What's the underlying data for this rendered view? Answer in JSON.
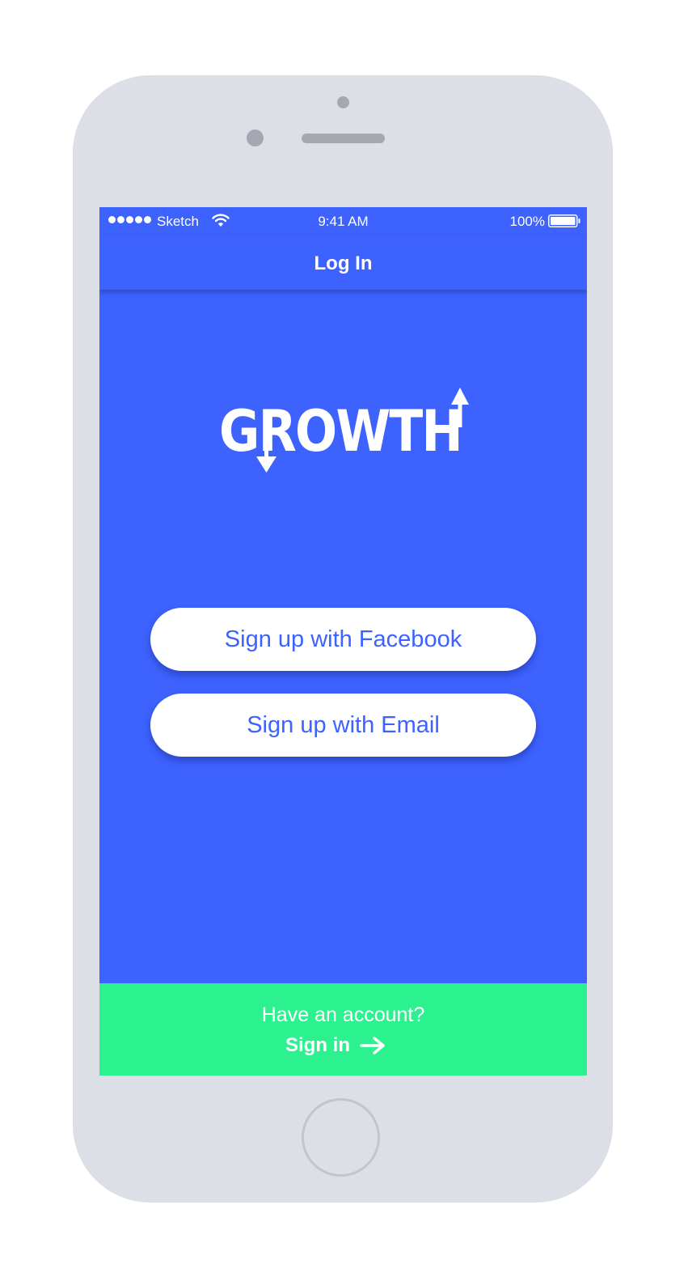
{
  "status_bar": {
    "carrier": "Sketch",
    "time": "9:41 AM",
    "battery": "100%"
  },
  "nav": {
    "title": "Log In"
  },
  "logo": {
    "text": "GROWTH"
  },
  "buttons": {
    "facebook": "Sign up with Facebook",
    "email": "Sign up with Email"
  },
  "footer": {
    "prompt": "Have an account?",
    "sign_in": "Sign in"
  },
  "colors": {
    "primary": "#3d62fe",
    "accent": "#2bf28f",
    "device": "#dcdfe6",
    "text_on_primary": "#ffffff"
  },
  "icons": {
    "signal": "signal-dots-icon",
    "wifi": "wifi-icon",
    "battery": "battery-icon",
    "sign_in_arrow": "arrow-right-icon"
  }
}
